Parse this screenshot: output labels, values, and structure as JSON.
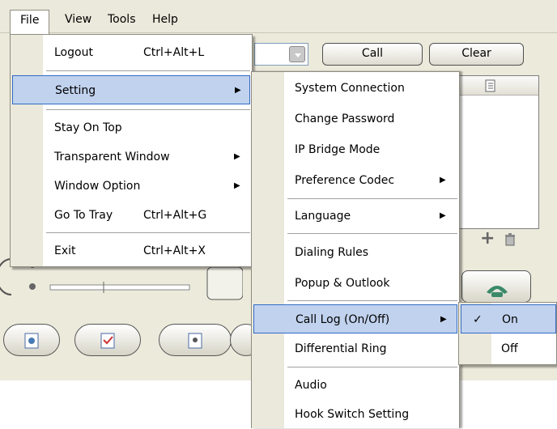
{
  "menubar": {
    "items": [
      {
        "label": "File"
      },
      {
        "label": "View"
      },
      {
        "label": "Tools"
      },
      {
        "label": "Help"
      }
    ]
  },
  "app": {
    "call_label": "Call",
    "clear_label": "Clear"
  },
  "file_menu": {
    "items": [
      {
        "label": "Logout",
        "shortcut": "Ctrl+Alt+L"
      },
      {
        "label": "Setting",
        "submenu": true
      },
      {
        "label": "Stay On Top"
      },
      {
        "label": "Transparent Window",
        "submenu": true
      },
      {
        "label": "Window Option",
        "submenu": true
      },
      {
        "label": "Go To Tray",
        "shortcut": "Ctrl+Alt+G"
      },
      {
        "label": "Exit",
        "shortcut": "Ctrl+Alt+X"
      }
    ]
  },
  "setting_menu": {
    "items": [
      {
        "label": "System Connection"
      },
      {
        "label": "Change Password"
      },
      {
        "label": "IP Bridge Mode"
      },
      {
        "label": "Preference Codec",
        "submenu": true
      },
      {
        "label": "Language",
        "submenu": true
      },
      {
        "label": "Dialing Rules"
      },
      {
        "label": "Popup & Outlook"
      },
      {
        "label": "Call Log (On/Off)",
        "submenu": true
      },
      {
        "label": "Differential Ring"
      },
      {
        "label": "Audio"
      },
      {
        "label": "Hook Switch Setting"
      }
    ]
  },
  "calllog_menu": {
    "items": [
      {
        "label": "On",
        "checked": true
      },
      {
        "label": "Off",
        "checked": false
      }
    ]
  },
  "icons": {
    "check": "✓",
    "submenu_arrow": "▶",
    "plus": "+",
    "trash": "trash-icon"
  },
  "colors": {
    "highlight": "#c1d2ee",
    "highlight_border": "#316ac5",
    "gutter": "#ebe9db"
  }
}
